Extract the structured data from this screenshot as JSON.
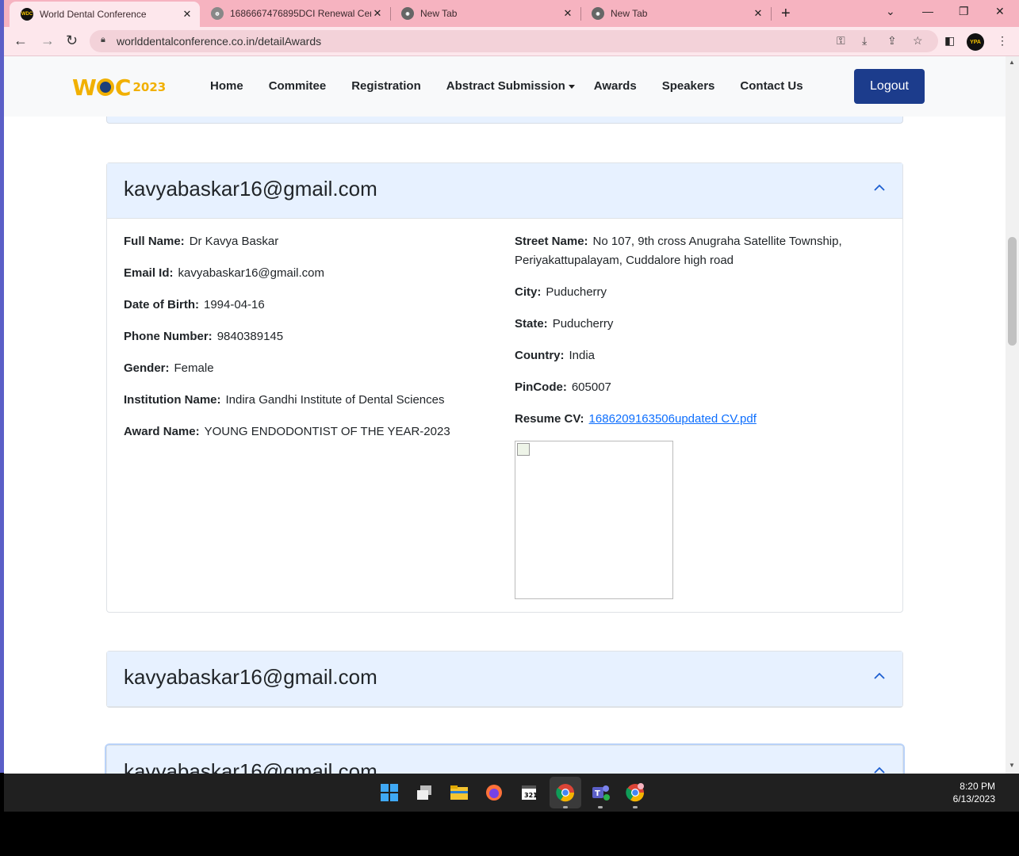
{
  "browser": {
    "tabs": [
      {
        "title": "World Dental Conference",
        "active": true
      },
      {
        "title": "1686667476895DCI Renewal Cer",
        "active": false
      },
      {
        "title": "New Tab",
        "active": false
      },
      {
        "title": "New Tab",
        "active": false
      }
    ],
    "url": "worlddentalconference.co.in/detailAwards",
    "profile_badge": "YPA"
  },
  "site": {
    "logo": {
      "text": "WDC",
      "year": "2023"
    },
    "nav": [
      "Home",
      "Commitee",
      "Registration",
      "Abstract Submission",
      "Awards",
      "Speakers",
      "Contact Us"
    ],
    "logout_label": "Logout"
  },
  "card1": {
    "email": "kavyabaskar16@gmail.com",
    "left": [
      {
        "label": "Full Name:",
        "value": "Dr Kavya Baskar"
      },
      {
        "label": "Email Id:",
        "value": "kavyabaskar16@gmail.com"
      },
      {
        "label": "Date of Birth:",
        "value": "1994-04-16"
      },
      {
        "label": "Phone Number:",
        "value": "9840389145"
      },
      {
        "label": "Gender:",
        "value": "Female"
      },
      {
        "label": "Institution Name:",
        "value": "Indira Gandhi Institute of Dental Sciences"
      },
      {
        "label": "Award Name:",
        "value": "YOUNG ENDODONTIST OF THE YEAR-2023"
      }
    ],
    "right": [
      {
        "label": "Street Name:",
        "value": "No 107, 9th cross Anugraha Satellite Township,",
        "value2": "Periyakattupalayam, Cuddalore high road"
      },
      {
        "label": "City:",
        "value": "Puducherry"
      },
      {
        "label": "State:",
        "value": "Puducherry"
      },
      {
        "label": "Country:",
        "value": "India"
      },
      {
        "label": "PinCode:",
        "value": "605007"
      },
      {
        "label": "Resume CV:",
        "value": "1686209163506updated CV.pdf"
      }
    ]
  },
  "card2": {
    "email": "kavyabaskar16@gmail.com"
  },
  "card3": {
    "email": "kavyabaskar16@gmail.com"
  },
  "taskbar": {
    "time": "8:20 PM",
    "date": "6/13/2023"
  },
  "colors": {
    "accent": "#1c3c8c",
    "card_header": "#e7f1ff",
    "tabstrip": "#f6b3c0",
    "link": "#0d6efd"
  }
}
